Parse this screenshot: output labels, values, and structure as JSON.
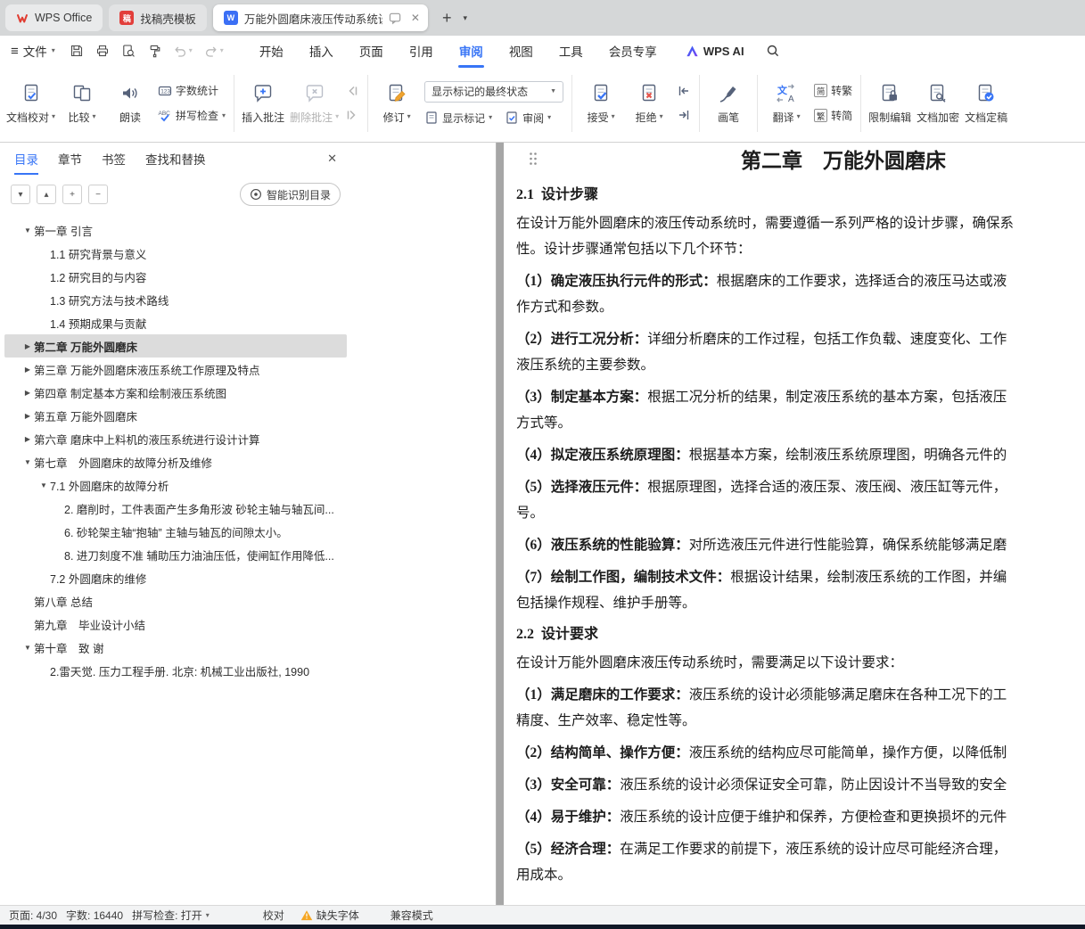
{
  "window": {
    "tabs": [
      {
        "label": "WPS Office"
      },
      {
        "label": "找稿壳模板"
      },
      {
        "label": "万能外圆磨床液压传动系统设..."
      }
    ]
  },
  "menubar": {
    "file": "文件",
    "items": [
      "开始",
      "插入",
      "页面",
      "引用",
      "审阅",
      "视图",
      "工具",
      "会员专享"
    ],
    "active_item": "审阅",
    "ai": "WPS AI"
  },
  "ribbon": {
    "doc_proof": "文档校对",
    "compare": "比较",
    "read_aloud": "朗读",
    "word_count": "字数统计",
    "spell_check": "拼写检查",
    "insert_comment": "插入批注",
    "delete_comment": "删除批注",
    "revise": "修订",
    "markup_state": "显示标记的最终状态",
    "show_markup": "显示标记",
    "review": "审阅",
    "accept": "接受",
    "reject": "拒绝",
    "pen": "画笔",
    "translate": "翻译",
    "simp_badge": "简",
    "to_trad": "转繁",
    "trad_badge": "繁",
    "to_simp": "转简",
    "restrict_edit": "限制编辑",
    "encrypt": "文档加密",
    "finalize": "文档定稿"
  },
  "sidebar": {
    "tabs": [
      "目录",
      "章节",
      "书签",
      "查找和替换"
    ],
    "active_tab": "目录",
    "smart_toc": "智能识别目录",
    "tree": [
      {
        "label": "第一章 引言",
        "level": 1,
        "arrow": "down"
      },
      {
        "label": "1.1 研究背景与意义",
        "level": 2
      },
      {
        "label": "1.2 研究目的与内容",
        "level": 2
      },
      {
        "label": "1.3 研究方法与技术路线",
        "level": 2
      },
      {
        "label": "1.4 预期成果与贡献",
        "level": 2
      },
      {
        "label": "第二章 万能外圆磨床",
        "level": 1,
        "arrow": "right",
        "selected": true
      },
      {
        "label": "第三章 万能外圆磨床液压系统工作原理及特点",
        "level": 1,
        "arrow": "right"
      },
      {
        "label": "第四章 制定基本方案和绘制液压系统图",
        "level": 1,
        "arrow": "right"
      },
      {
        "label": "第五章 万能外圆磨床",
        "level": 1,
        "arrow": "right"
      },
      {
        "label": "第六章 磨床中上料机的液压系统进行设计计算",
        "level": 1,
        "arrow": "right"
      },
      {
        "label": "第七章　外圆磨床的故障分析及维修",
        "level": 1,
        "arrow": "down"
      },
      {
        "label": "7.1 外圆磨床的故障分析",
        "level": 2,
        "arrow": "down"
      },
      {
        "label": "2. 磨削时，工件表面产生多角形波 砂轮主轴与轴瓦间...",
        "level": 3
      },
      {
        "label": "6. 砂轮架主轴“抱轴” 主轴与轴瓦的间隙太小。",
        "level": 3
      },
      {
        "label": "8. 进刀刻度不准 辅助压力油油压低，使闸缸作用降低...",
        "level": 3
      },
      {
        "label": "7.2 外圆磨床的维修",
        "level": 2
      },
      {
        "label": "第八章 总结",
        "level": 1
      },
      {
        "label": "第九章　毕业设计小结",
        "level": 1
      },
      {
        "label": "第十章　致 谢",
        "level": 1,
        "arrow": "down"
      },
      {
        "label": "2.雷天觉. 压力工程手册. 北京: 机械工业出版社, 1990",
        "level": 2
      }
    ]
  },
  "document": {
    "title": "第二章　万能外圆磨床",
    "blocks": [
      {
        "type": "h2",
        "text": "2.1  设计步骤"
      },
      {
        "type": "p",
        "lines": [
          {
            "t": "在设计万能外圆磨床的液压传动系统时，需要遵循一系列严格的设计步骤，确保系"
          },
          {
            "t": "性。设计步骤通常包括以下几个环节："
          }
        ]
      },
      {
        "type": "p",
        "lines": [
          {
            "b": "（1）确定液压执行元件的形式：",
            "t": "根据磨床的工作要求，选择适合的液压马达或液"
          },
          {
            "t": "作方式和参数。"
          }
        ]
      },
      {
        "type": "p",
        "lines": [
          {
            "b": "（2）进行工况分析：",
            "t": "详细分析磨床的工作过程，包括工作负载、速度变化、工作"
          },
          {
            "t": "液压系统的主要参数。"
          }
        ]
      },
      {
        "type": "p",
        "lines": [
          {
            "b": "（3）制定基本方案：",
            "t": "根据工况分析的结果，制定液压系统的基本方案，包括液压"
          },
          {
            "t": "方式等。"
          }
        ]
      },
      {
        "type": "p",
        "lines": [
          {
            "b": "（4）拟定液压系统原理图：",
            "t": "根据基本方案，绘制液压系统原理图，明确各元件的"
          }
        ]
      },
      {
        "type": "p",
        "lines": [
          {
            "b": "（5）选择液压元件：",
            "t": "根据原理图，选择合适的液压泵、液压阀、液压缸等元件，"
          },
          {
            "t": "号。"
          }
        ]
      },
      {
        "type": "p",
        "lines": [
          {
            "b": "（6）液压系统的性能验算：",
            "t": "对所选液压元件进行性能验算，确保系统能够满足磨"
          }
        ]
      },
      {
        "type": "p",
        "lines": [
          {
            "b": "（7）绘制工作图，编制技术文件：",
            "t": "根据设计结果，绘制液压系统的工作图，并编"
          },
          {
            "t": "包括操作规程、维护手册等。"
          }
        ]
      },
      {
        "type": "h2",
        "text": "2.2  设计要求"
      },
      {
        "type": "p",
        "lines": [
          {
            "t": "在设计万能外圆磨床液压传动系统时，需要满足以下设计要求："
          }
        ]
      },
      {
        "type": "p",
        "lines": [
          {
            "b": "（1）满足磨床的工作要求：",
            "t": "液压系统的设计必须能够满足磨床在各种工况下的工"
          },
          {
            "t": "精度、生产效率、稳定性等。"
          }
        ]
      },
      {
        "type": "p",
        "lines": [
          {
            "b": "（2）结构简单、操作方便：",
            "t": "液压系统的结构应尽可能简单，操作方便，以降低制"
          }
        ]
      },
      {
        "type": "p",
        "lines": [
          {
            "b": "（3）安全可靠：",
            "t": "液压系统的设计必须保证安全可靠，防止因设计不当导致的安全"
          }
        ]
      },
      {
        "type": "p",
        "lines": [
          {
            "b": "（4）易于维护：",
            "t": "液压系统的设计应便于维护和保养，方便检查和更换损坏的元件"
          }
        ]
      },
      {
        "type": "p",
        "lines": [
          {
            "b": "（5）经济合理：",
            "t": "在满足工作要求的前提下，液压系统的设计应尽可能经济合理，"
          },
          {
            "t": "用成本。"
          }
        ]
      }
    ]
  },
  "statusbar": {
    "page": "页面: 4/30",
    "words": "字数: 16440",
    "spellcheck": "拼写检查: 打开",
    "proof": "校对",
    "missing_font": "缺失字体",
    "compat_mode": "兼容模式"
  },
  "icons": {
    "hamburger": "≡",
    "dropdown": "▾",
    "combo_arrow": "▼",
    "expanded": "▼",
    "collapsed": "▶",
    "close": "✕",
    "new_tab": "+",
    "chevron_down": "▾",
    "chevron_up": "▴",
    "plus": "+",
    "minus": "−"
  },
  "colors": {
    "accent_blue": "#3875f6",
    "warning_orange": "#f5a623",
    "reject_red": "#e5544b"
  }
}
